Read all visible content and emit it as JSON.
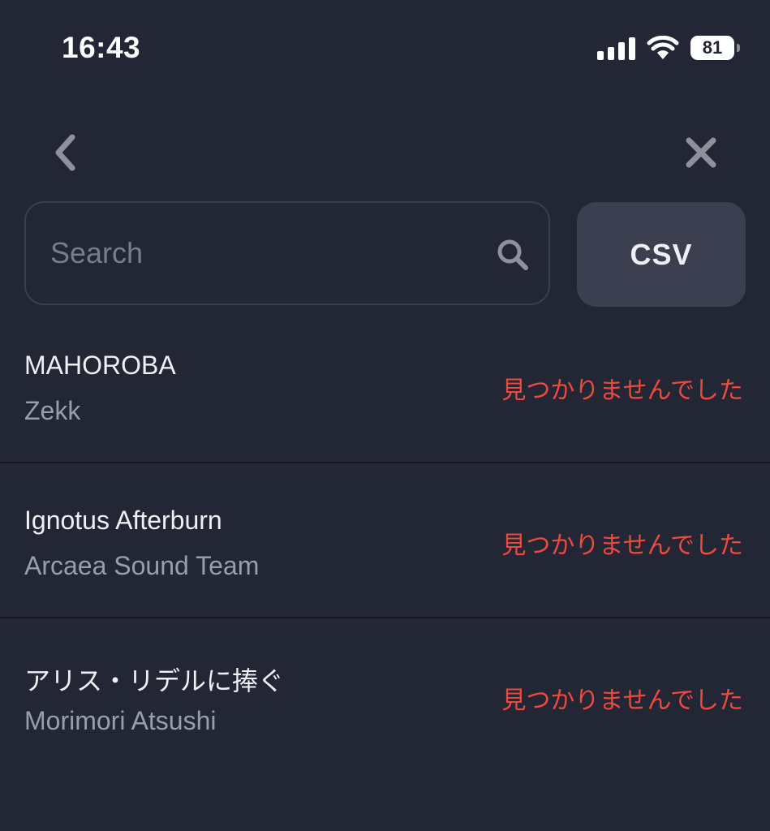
{
  "status_bar": {
    "time": "16:43",
    "battery": "81",
    "icons": [
      "signal-icon",
      "wifi-icon",
      "battery-icon"
    ]
  },
  "nav": {
    "back_icon": "chevron-left-icon",
    "close_icon": "close-icon"
  },
  "search": {
    "placeholder": "Search",
    "value": "",
    "icon": "search-icon"
  },
  "csv_button": {
    "label": "CSV"
  },
  "items": [
    {
      "title": "MAHOROBA",
      "artist": "Zekk",
      "status": "見つかりませんでした"
    },
    {
      "title": "Ignotus Afterburn",
      "artist": "Arcaea Sound Team",
      "status": "見つかりませんでした"
    },
    {
      "title": "アリス・リデルに捧ぐ",
      "artist": "Morimori Atsushi",
      "status": "見つかりませんでした"
    }
  ],
  "colors": {
    "background": "#232634",
    "button": "#3b3f4f",
    "status_error": "#ec4a3f",
    "secondary_text": "#9a9daa"
  }
}
